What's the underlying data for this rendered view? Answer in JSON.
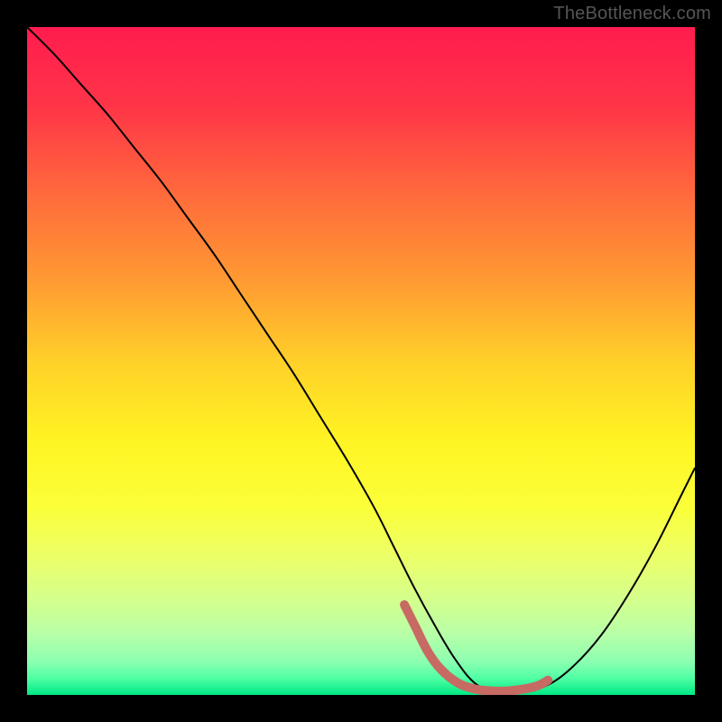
{
  "watermark": "TheBottleneck.com",
  "chart_data": {
    "type": "line",
    "title": "",
    "xlabel": "",
    "ylabel": "",
    "xlim": [
      0,
      100
    ],
    "ylim": [
      0,
      100
    ],
    "grid": false,
    "legend": null,
    "background_gradient": {
      "colors": [
        {
          "offset": 0.0,
          "color": "#ff1c4f"
        },
        {
          "offset": 0.12,
          "color": "#ff3547"
        },
        {
          "offset": 0.25,
          "color": "#ff6a3c"
        },
        {
          "offset": 0.38,
          "color": "#ff9a32"
        },
        {
          "offset": 0.5,
          "color": "#ffd029"
        },
        {
          "offset": 0.62,
          "color": "#fff423"
        },
        {
          "offset": 0.72,
          "color": "#fbff3a"
        },
        {
          "offset": 0.8,
          "color": "#eaff6c"
        },
        {
          "offset": 0.86,
          "color": "#d3ff8e"
        },
        {
          "offset": 0.91,
          "color": "#b7ffa8"
        },
        {
          "offset": 0.95,
          "color": "#8cffb1"
        },
        {
          "offset": 0.975,
          "color": "#4fffa4"
        },
        {
          "offset": 1.0,
          "color": "#00e884"
        }
      ]
    },
    "series": [
      {
        "name": "bottleneck-curve",
        "color": "#000000",
        "stroke_width": 2,
        "x": [
          0,
          4,
          8,
          12,
          16,
          20,
          24,
          28,
          32,
          36,
          40,
          44,
          48,
          52,
          55,
          58,
          61,
          64,
          67,
          70,
          74,
          78,
          82,
          86,
          90,
          94,
          98,
          100
        ],
        "y": [
          100,
          96,
          91.5,
          87,
          82,
          77,
          71.5,
          66,
          60,
          54,
          48,
          41.5,
          35,
          28,
          22,
          16,
          10.5,
          5.5,
          1.8,
          0.5,
          0.5,
          1.5,
          4.5,
          9,
          15,
          22,
          30,
          34
        ]
      },
      {
        "name": "optimal-range-highlight",
        "color": "#c86a64",
        "stroke_width": 10,
        "linecap": "round",
        "x": [
          56.5,
          58.0,
          60.0,
          62.0,
          64.5,
          67.0,
          69.5,
          72.0,
          74.5,
          76.5,
          78.0
        ],
        "y": [
          13.5,
          10.5,
          6.5,
          3.8,
          1.8,
          0.9,
          0.6,
          0.6,
          0.9,
          1.4,
          2.2
        ]
      }
    ]
  }
}
